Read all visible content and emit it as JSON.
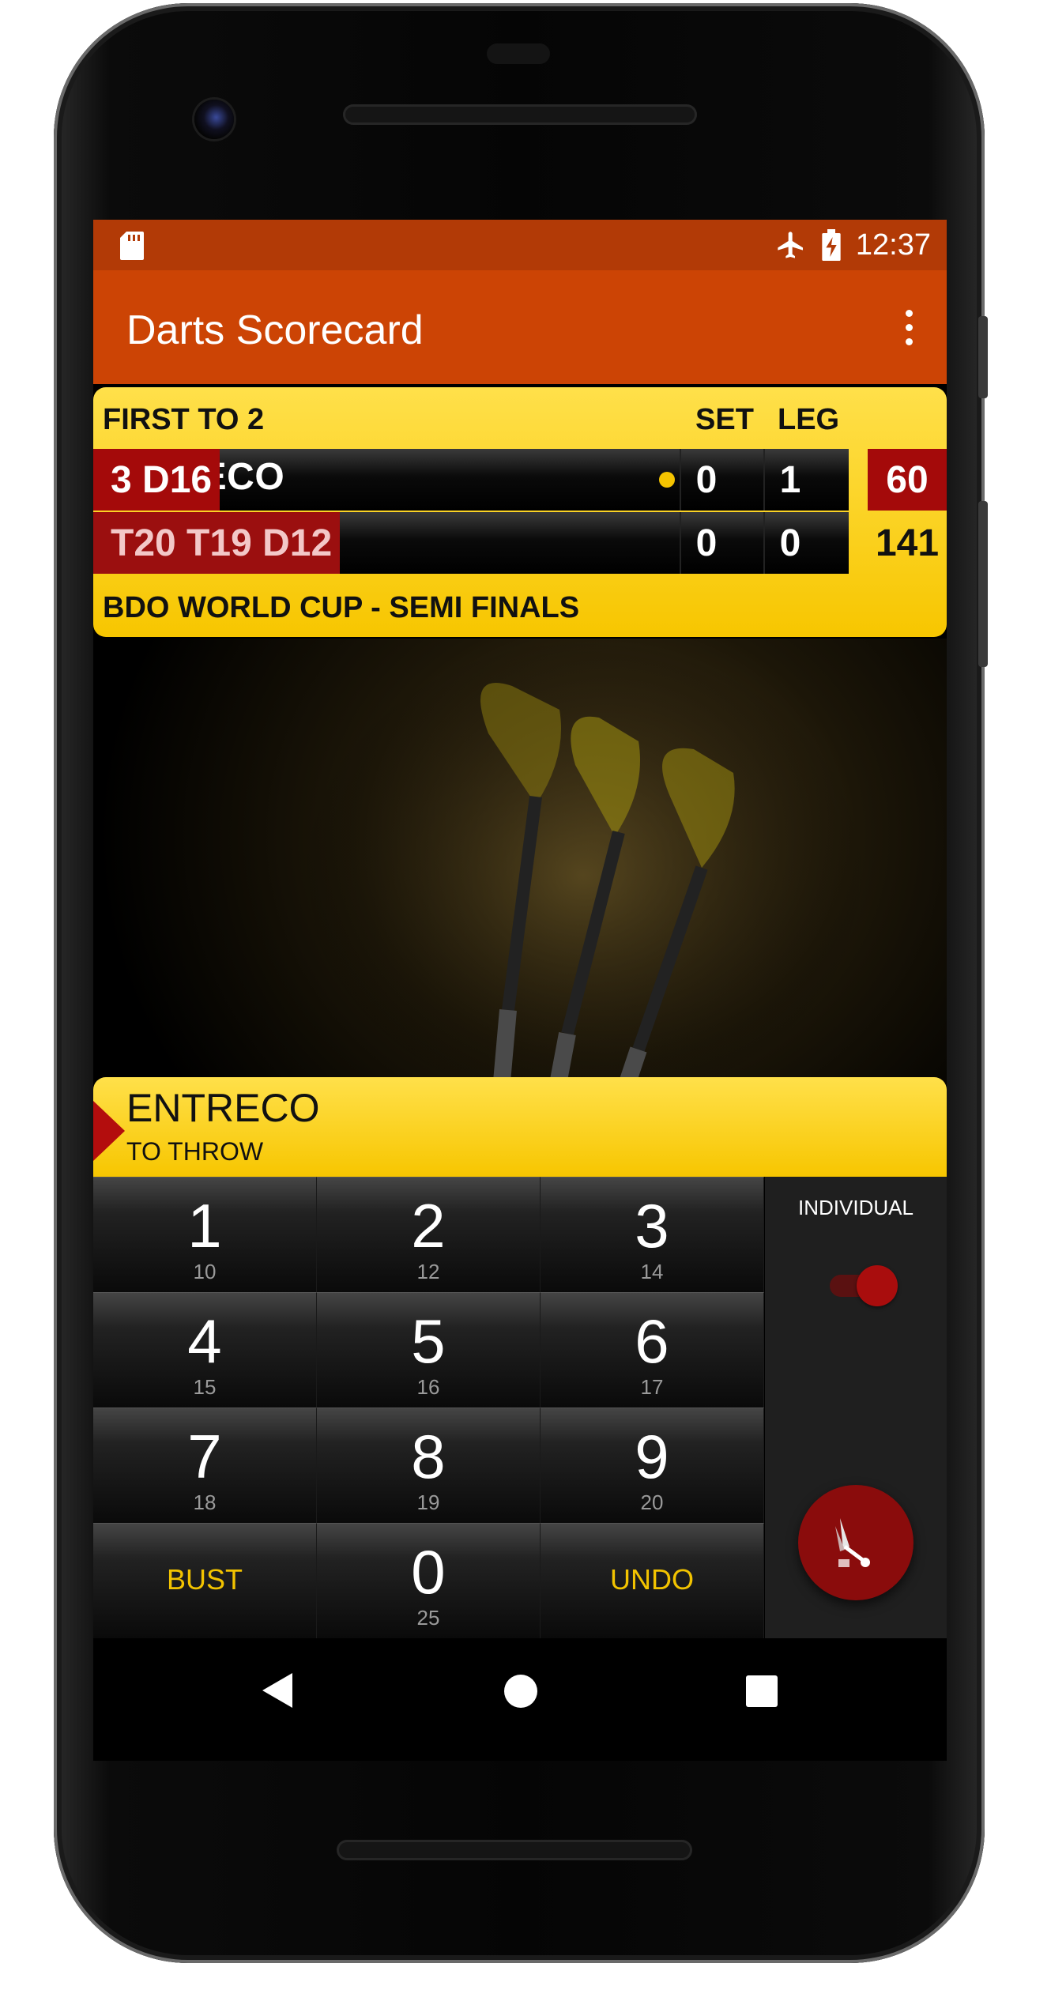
{
  "status_bar": {
    "time": "12:37",
    "icons": [
      "sd-card-icon",
      "airplane-icon",
      "battery-charging-icon"
    ]
  },
  "app_bar": {
    "title": "Darts Scorecard",
    "menu_icon": "more-vert-icon"
  },
  "scoreboard": {
    "header": "FIRST TO 2",
    "col_set": "SET",
    "col_leg": "LEG",
    "players": [
      {
        "name": "ENTRECO",
        "checkout": "3 D16",
        "set": "0",
        "leg": "1",
        "score": "60",
        "throwing": true
      },
      {
        "name": "",
        "checkout": "T20 T19 D12",
        "set": "0",
        "leg": "0",
        "score": "141",
        "throwing": false
      }
    ],
    "footer": "BDO WORLD CUP - SEMI FINALS"
  },
  "throw_bar": {
    "player": "ENTRECO",
    "subtitle": "TO THROW"
  },
  "keypad": {
    "keys": [
      {
        "main": "1",
        "sub": "10"
      },
      {
        "main": "2",
        "sub": "12"
      },
      {
        "main": "3",
        "sub": "14"
      },
      {
        "main": "4",
        "sub": "15"
      },
      {
        "main": "5",
        "sub": "16"
      },
      {
        "main": "6",
        "sub": "17"
      },
      {
        "main": "7",
        "sub": "18"
      },
      {
        "main": "8",
        "sub": "19"
      },
      {
        "main": "9",
        "sub": "20"
      },
      {
        "main": "0",
        "sub": "25"
      }
    ],
    "bust_label": "BUST",
    "undo_label": "UNDO"
  },
  "side_panel": {
    "mode_label": "INDIVIDUAL",
    "toggle_on": true,
    "fab_icon": "dart-icon"
  },
  "colors": {
    "status_bar": "#b23a06",
    "app_bar": "#cc4405",
    "accent_yellow": "#f7c600",
    "accent_red": "#a40a0a"
  }
}
